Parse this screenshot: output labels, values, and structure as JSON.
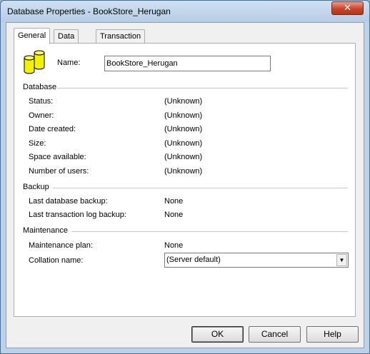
{
  "window": {
    "title": "Database Properties - BookStore_Herugan",
    "close_glyph": "✕"
  },
  "tabs": [
    {
      "label": "General",
      "active": true
    },
    {
      "label": "Data Files",
      "active": false
    },
    {
      "label": "Transaction Log",
      "active": false
    }
  ],
  "general": {
    "name_label": "Name:",
    "name_value": "BookStore_Herugan",
    "icon": "database-icon"
  },
  "database": {
    "section": "Database",
    "rows": [
      {
        "label": "Status:",
        "value": "(Unknown)"
      },
      {
        "label": "Owner:",
        "value": "(Unknown)"
      },
      {
        "label": "Date created:",
        "value": "(Unknown)"
      },
      {
        "label": "Size:",
        "value": "(Unknown)"
      },
      {
        "label": "Space available:",
        "value": "(Unknown)"
      },
      {
        "label": "Number of users:",
        "value": "(Unknown)"
      }
    ]
  },
  "backup": {
    "section": "Backup",
    "rows": [
      {
        "label": "Last database backup:",
        "value": "None"
      },
      {
        "label": "Last transaction log backup:",
        "value": "None"
      }
    ]
  },
  "maintenance": {
    "section": "Maintenance",
    "plan_label": "Maintenance plan:",
    "plan_value": "None",
    "collation_label": "Collation name:",
    "collation_value": "(Server default)"
  },
  "buttons": {
    "ok": "OK",
    "cancel": "Cancel",
    "help": "Help"
  },
  "colors": {
    "title_bar": "#b6cde6",
    "close_button": "#c7442b",
    "icon_yellow": "#f3f000"
  }
}
